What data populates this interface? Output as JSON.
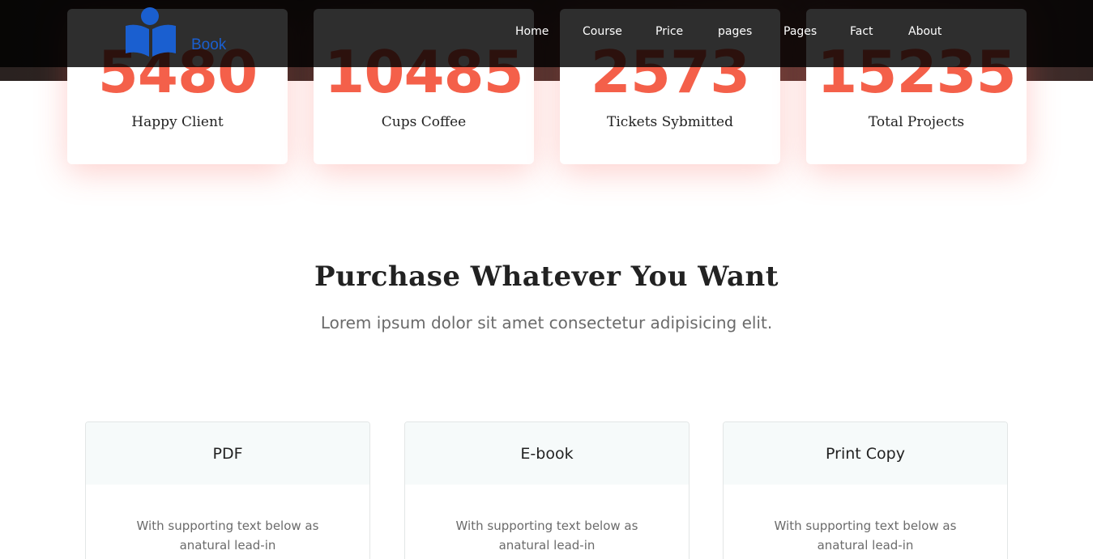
{
  "header": {
    "logo_text": "Book",
    "nav": [
      "Home",
      "Course",
      "Price",
      "pages",
      "Pages",
      "Fact",
      "About"
    ]
  },
  "stats": [
    {
      "number": "5480",
      "label": "Happy Client"
    },
    {
      "number": "10485",
      "label": "Cups Coffee"
    },
    {
      "number": "2573",
      "label": "Tickets Sybmitted"
    },
    {
      "number": "15235",
      "label": "Total Projects"
    }
  ],
  "section": {
    "title": "Purchase Whatever You Want",
    "subtitle": "Lorem ipsum dolor sit amet consectetur adipisicing elit."
  },
  "plans": [
    {
      "title": "PDF",
      "text": "With supporting text below as anatural lead-in"
    },
    {
      "title": "E-book",
      "text": "With supporting text below as anatural lead-in"
    },
    {
      "title": "Print Copy",
      "text": "With supporting text below as anatural lead-in"
    }
  ],
  "colors": {
    "accent": "#f4604a",
    "logo_blue": "#1a5fd0"
  },
  "icons": {
    "logo": "book-reader-icon"
  }
}
